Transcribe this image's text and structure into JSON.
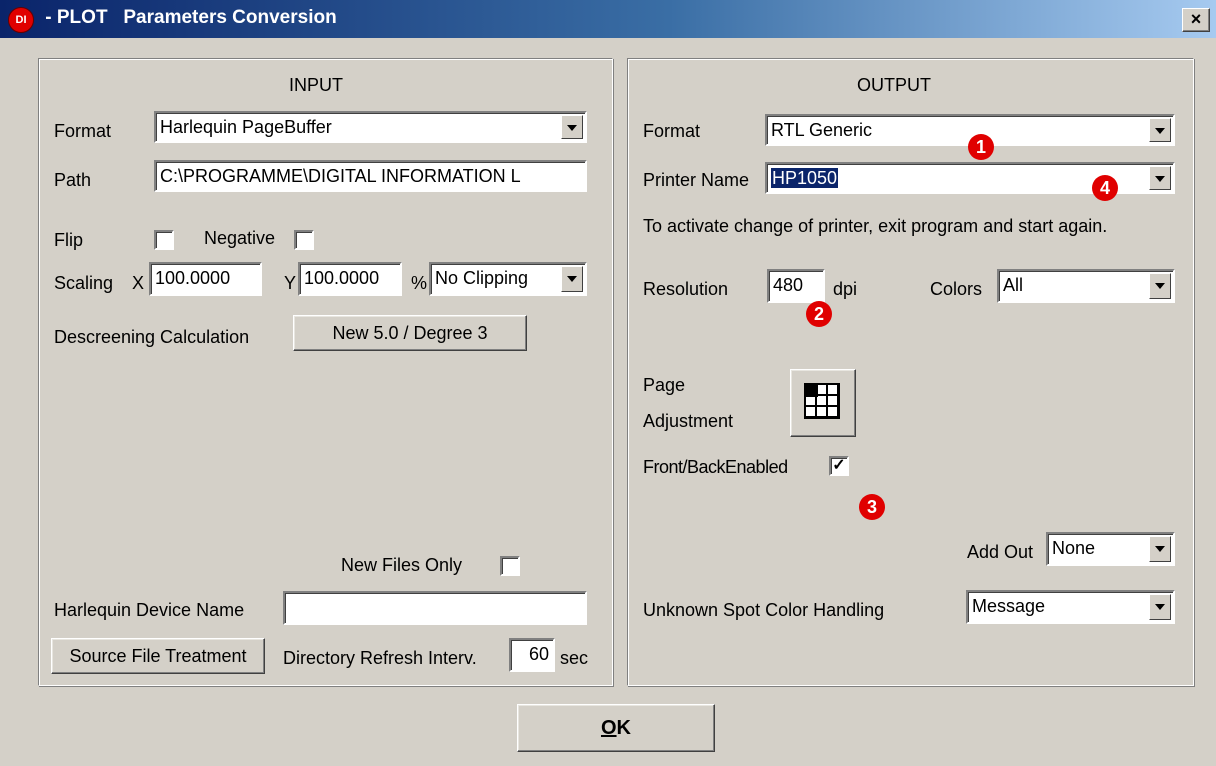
{
  "window": {
    "title": " - PLOT   Parameters Conversion",
    "app_icon_text": "DI",
    "close_symbol": "×"
  },
  "input": {
    "heading": "INPUT",
    "format_label": "Format",
    "format_value": "Harlequin PageBuffer",
    "path_label": "Path",
    "path_value": "C:\\PROGRAMME\\DIGITAL INFORMATION L",
    "flip_label": "Flip",
    "flip_checked": false,
    "negative_label": "Negative",
    "negative_checked": false,
    "scaling_label": "Scaling",
    "x_label": "X",
    "x_value": "100.0000",
    "y_label": "Y",
    "y_value": "100.0000",
    "percent_label": "%",
    "clipping_value": "No Clipping",
    "descreening_label": "Descreening Calculation",
    "descreening_button": "New 5.0 / Degree 3",
    "new_files_only_label": "New Files Only",
    "new_files_only_checked": false,
    "device_name_label": "Harlequin Device Name",
    "device_name_value": "",
    "source_button": "Source File Treatment",
    "refresh_label": "Directory Refresh Interv.",
    "refresh_value": "60",
    "refresh_unit": "sec"
  },
  "output": {
    "heading": "OUTPUT",
    "format_label": "Format",
    "format_value": "RTL Generic",
    "printer_label": "Printer Name",
    "printer_value": "HP1050",
    "hint": "To activate change of printer, exit program and start again.",
    "resolution_label": "Resolution",
    "resolution_value": "480",
    "resolution_unit": "dpi",
    "colors_label": "Colors",
    "colors_value": "All",
    "page_label_line1": "Page",
    "page_label_line2": "Adjustment",
    "front_back_label": "Front/BackEnabled",
    "front_back_checked": true,
    "check_mark": "✓",
    "add_out_label": "Add Out",
    "add_out_value": "None",
    "spot_label": "Unknown Spot Color Handling",
    "spot_value": "Message"
  },
  "badges": [
    "1",
    "2",
    "3",
    "4"
  ],
  "ok_underlined": "O",
  "ok_rest": "K"
}
